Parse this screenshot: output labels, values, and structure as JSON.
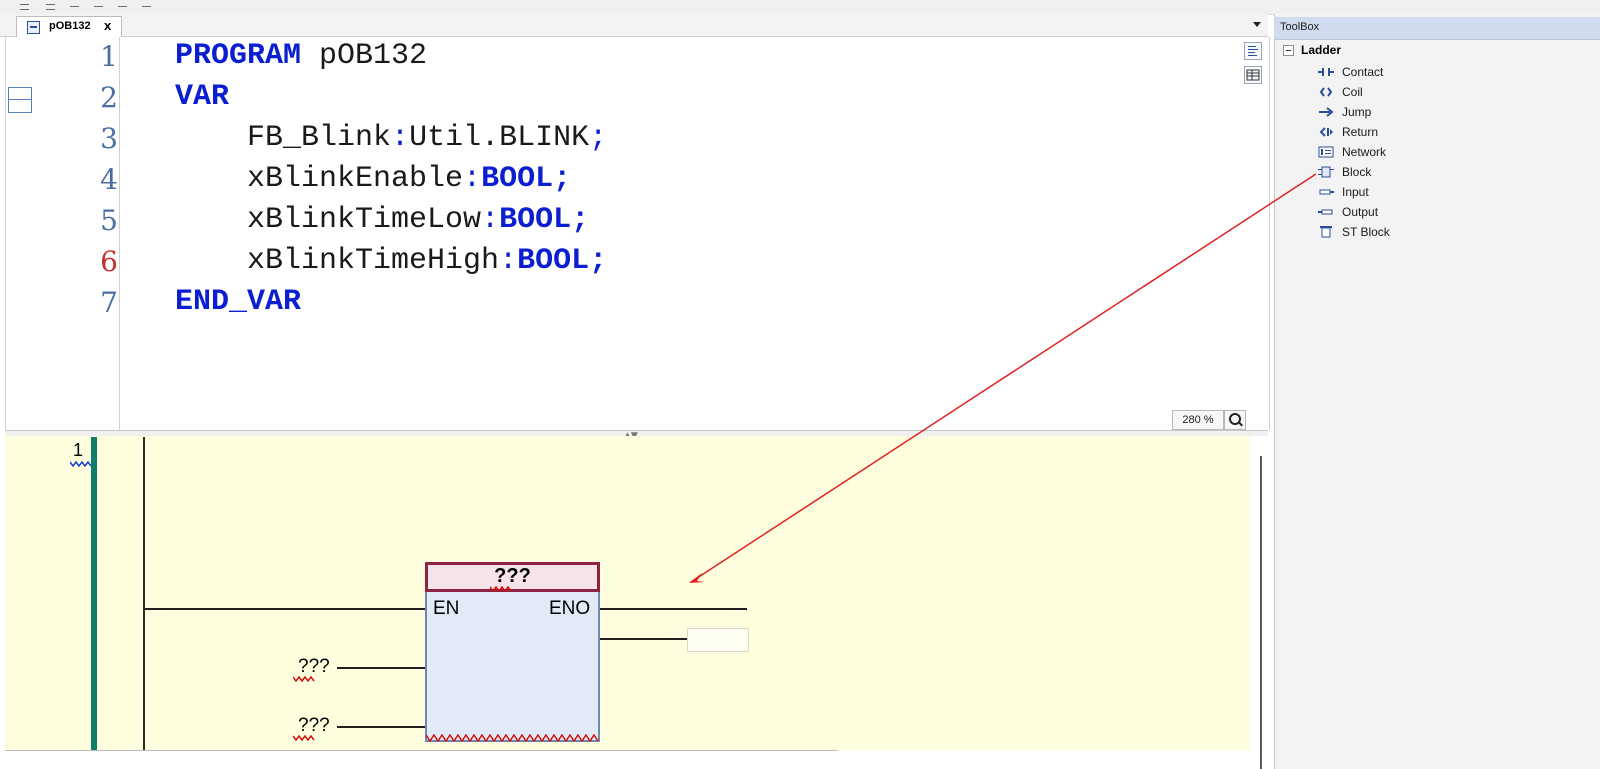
{
  "editor": {
    "tab": {
      "label": "pOB132",
      "close": "x"
    },
    "line_numbers": [
      "1",
      "2",
      "3",
      "4",
      "5",
      "6",
      "7"
    ],
    "code": {
      "l1": {
        "kw": "PROGRAM",
        "rest": " pOB132"
      },
      "l2": {
        "kw": "VAR"
      },
      "l3": {
        "name": "    FB_Blink",
        "sep": ":",
        "type": "Util.BLINK",
        "end": ";"
      },
      "l4": {
        "name": "    xBlinkEnable",
        "sep": ":",
        "type": "BOOL",
        "end": ";"
      },
      "l5": {
        "name": "    xBlinkTimeLow",
        "sep": ":",
        "type": "BOOL",
        "end": ";"
      },
      "l6": {
        "name": "    xBlinkTimeHigh",
        "sep": ":",
        "type": "BOOL",
        "end": ";"
      },
      "l7": {
        "kw": "END_VAR"
      }
    },
    "zoom": "280 %"
  },
  "ladder": {
    "network_number": "1",
    "block": {
      "title": "???",
      "en": "EN",
      "eno": "ENO",
      "inputs": [
        "???",
        "???"
      ]
    }
  },
  "toolbox": {
    "title": "ToolBox",
    "category": "Ladder",
    "items": [
      {
        "label": "Contact",
        "icon": "contact-icon"
      },
      {
        "label": "Coil",
        "icon": "coil-icon"
      },
      {
        "label": "Jump",
        "icon": "jump-icon"
      },
      {
        "label": "Return",
        "icon": "return-icon"
      },
      {
        "label": "Network",
        "icon": "network-icon"
      },
      {
        "label": "Block",
        "icon": "block-icon"
      },
      {
        "label": "Input",
        "icon": "input-icon"
      },
      {
        "label": "Output",
        "icon": "output-icon"
      },
      {
        "label": "ST Block",
        "icon": "st-block-icon"
      }
    ]
  },
  "colors": {
    "keyword": "#0b1fd0",
    "ladder_background": "#fefedf",
    "block_header": "#f7e3ea",
    "block_body": "#e2e9f7",
    "network_marker": "#0f7d6a",
    "annotation_arrow": "#e02020",
    "error_squiggle": "#d01010"
  }
}
